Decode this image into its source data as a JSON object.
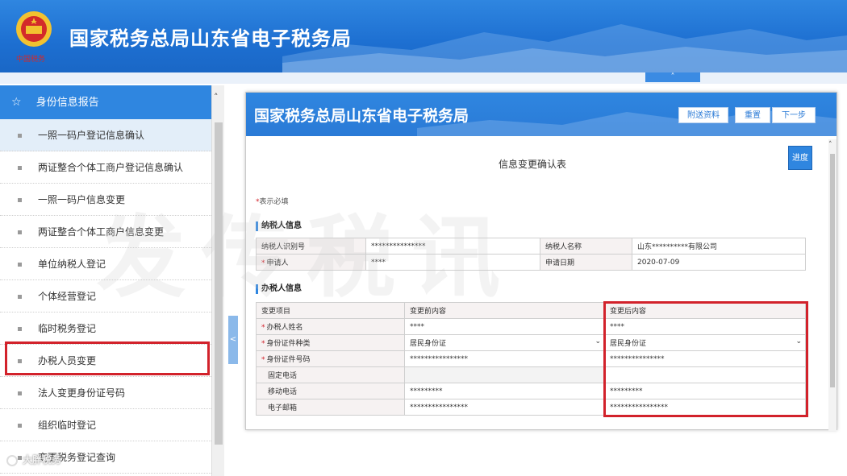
{
  "header": {
    "title": "国家税务总局山东省电子税务局",
    "emblem_icon": "tax-emblem-icon"
  },
  "sidebar": {
    "section_title": "身份信息报告",
    "items": [
      {
        "label": "一照一码户登记信息确认",
        "active": true
      },
      {
        "label": "两证整合个体工商户登记信息确认",
        "active": false
      },
      {
        "label": "一照一码户信息变更",
        "active": false
      },
      {
        "label": "两证整合个体工商户信息变更",
        "active": false
      },
      {
        "label": "单位纳税人登记",
        "active": false
      },
      {
        "label": "个体经营登记",
        "active": false
      },
      {
        "label": "临时税务登记",
        "active": false
      },
      {
        "label": "办税人员变更",
        "active": false,
        "highlighted": true
      },
      {
        "label": "法人变更身份证号码",
        "active": false
      },
      {
        "label": "组织临时登记",
        "active": false
      },
      {
        "label": "变更税务登记查询",
        "active": false
      }
    ]
  },
  "panel": {
    "title": "国家税务总局山东省电子税务局",
    "buttons": {
      "attach": "附送资料",
      "reset": "重置",
      "next": "下一步"
    },
    "progress_button": "进度",
    "form_title": "信息变更确认表",
    "required_note": "表示必填",
    "taxpayer_section": "纳税人信息",
    "taxpayer": {
      "id_label": "纳税人识别号",
      "id_value": "***************",
      "name_label": "纳税人名称",
      "name_value": "山东**********有限公司",
      "applicant_label": "申请人",
      "applicant_value": "****",
      "date_label": "申请日期",
      "date_value": "2020-07-09"
    },
    "agent_section": "办税人信息",
    "change_table": {
      "headers": [
        "变更项目",
        "变更前内容",
        "变更后内容"
      ],
      "rows": [
        {
          "item": "办税人姓名",
          "required": true,
          "before": "****",
          "after": "****",
          "select": false
        },
        {
          "item": "身份证件种类",
          "required": true,
          "before": "居民身份证",
          "after": "居民身份证",
          "select": true
        },
        {
          "item": "身份证件号码",
          "required": true,
          "before": "****************",
          "after": "***************",
          "select": false
        },
        {
          "item": "固定电话",
          "required": false,
          "before": "",
          "after": "",
          "select": false
        },
        {
          "item": "移动电话",
          "required": false,
          "before": "*********",
          "after": "*********",
          "select": false
        },
        {
          "item": "电子邮箱",
          "required": false,
          "before": "****************",
          "after": "****************",
          "select": false
        }
      ]
    }
  },
  "watermark": "发传税讯",
  "credit": "大胖税务",
  "colors": {
    "brand_blue": "#2f86e0",
    "highlight_red": "#d2222b"
  }
}
